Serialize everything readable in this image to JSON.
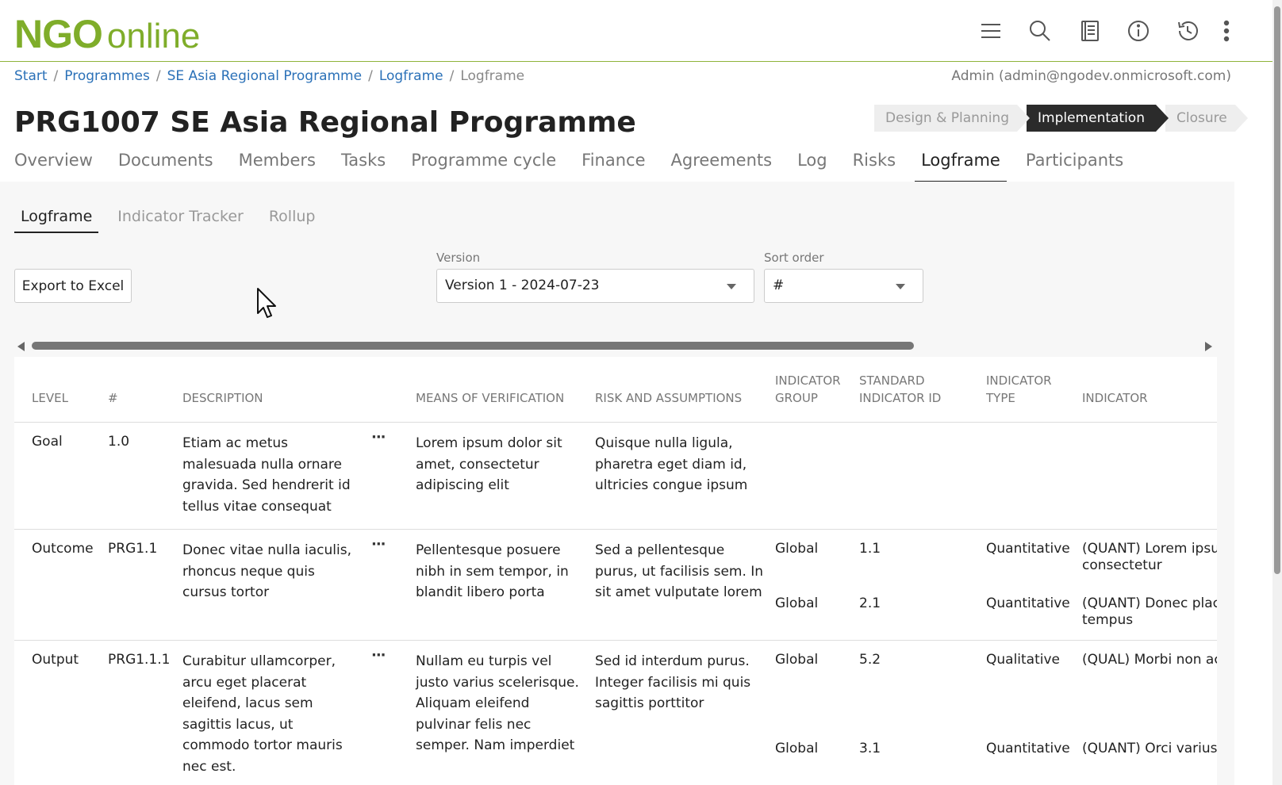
{
  "header": {
    "logo_main": "NGO",
    "logo_sub": "online",
    "icons": [
      "menu-icon",
      "search-icon",
      "notebook-icon",
      "info-icon",
      "history-icon",
      "more-vertical-icon"
    ]
  },
  "breadcrumb": {
    "items": [
      "Start",
      "Programmes",
      "SE Asia Regional Programme",
      "Logframe"
    ],
    "current": "Logframe",
    "separator": "/"
  },
  "user": "Admin (admin@ngodev.onmicrosoft.com)",
  "page_title": "PRG1007 SE Asia Regional Programme",
  "stages": [
    "Design & Planning",
    "Implementation",
    "Closure"
  ],
  "active_stage": "Implementation",
  "tabs": [
    "Overview",
    "Documents",
    "Members",
    "Tasks",
    "Programme cycle",
    "Finance",
    "Agreements",
    "Log",
    "Risks",
    "Logframe",
    "Participants"
  ],
  "active_tab": "Logframe",
  "subtabs": [
    "Logframe",
    "Indicator Tracker",
    "Rollup"
  ],
  "active_subtab": "Logframe",
  "export_button": "Export to Excel",
  "version": {
    "label": "Version",
    "value": "Version 1 - 2024-07-23"
  },
  "sort_order": {
    "label": "Sort order",
    "value": "#"
  },
  "table": {
    "headers": {
      "level": "LEVEL",
      "num": "#",
      "description": "DESCRIPTION",
      "mov": "MEANS OF VERIFICATION",
      "risk": "RISK AND ASSUMPTIONS",
      "group_1": "INDICATOR",
      "group_2": "GROUP",
      "std_1": "STANDARD",
      "std_2": "INDICATOR ID",
      "type_1": "INDICATOR",
      "type_2": "TYPE",
      "indicator": "INDICATOR"
    },
    "rows": [
      {
        "level": "Goal",
        "num": "1.0",
        "description": "Etiam ac metus malesuada nulla ornare gravida. Sed hendrerit id tellus vitae consequat",
        "mov": "Lorem ipsum dolor sit amet, consectetur adipiscing elit",
        "risk": "Quisque nulla ligula, pharetra eget diam id, ultricies congue ipsum",
        "indicators": []
      },
      {
        "level": "Outcome",
        "num": "PRG1.1",
        "description": "Donec vitae nulla iaculis, rhoncus neque quis cursus tortor",
        "mov": "Pellentesque posuere nibh in sem tempor, in blandit libero porta",
        "risk": "Sed a pellentesque purus, ut facilisis sem. In sit amet vulputate lorem",
        "indicators": [
          {
            "group": "Global",
            "std_id": "1.1",
            "type": "Quantitative",
            "line1": "(QUANT) Lorem ipsum",
            "line2": "consectetur"
          },
          {
            "group": "Global",
            "std_id": "2.1",
            "type": "Quantitative",
            "line1": "(QUANT) Donec place",
            "line2": "tempus"
          }
        ]
      },
      {
        "level": "Output",
        "num": "PRG1.1.1",
        "description": "Curabitur ullamcorper, arcu eget placerat eleifend, lacus sem sagittis lacus, ut commodo tortor mauris nec est.",
        "mov": "Nullam eu turpis vel justo varius scelerisque. Aliquam eleifend pulvinar felis nec semper. Nam imperdiet",
        "risk": "Sed id interdum purus. Integer facilisis mi quis sagittis porttitor",
        "indicators": [
          {
            "group": "Global",
            "std_id": "5.2",
            "type": "Qualitative",
            "line1": "(QUAL) Morbi non acc",
            "line2": ""
          },
          {
            "group": "Global",
            "std_id": "3.1",
            "type": "Quantitative",
            "line1": "(QUANT) Orci varius n",
            "line2": ""
          }
        ]
      }
    ]
  },
  "row_menu_glyph": "···"
}
